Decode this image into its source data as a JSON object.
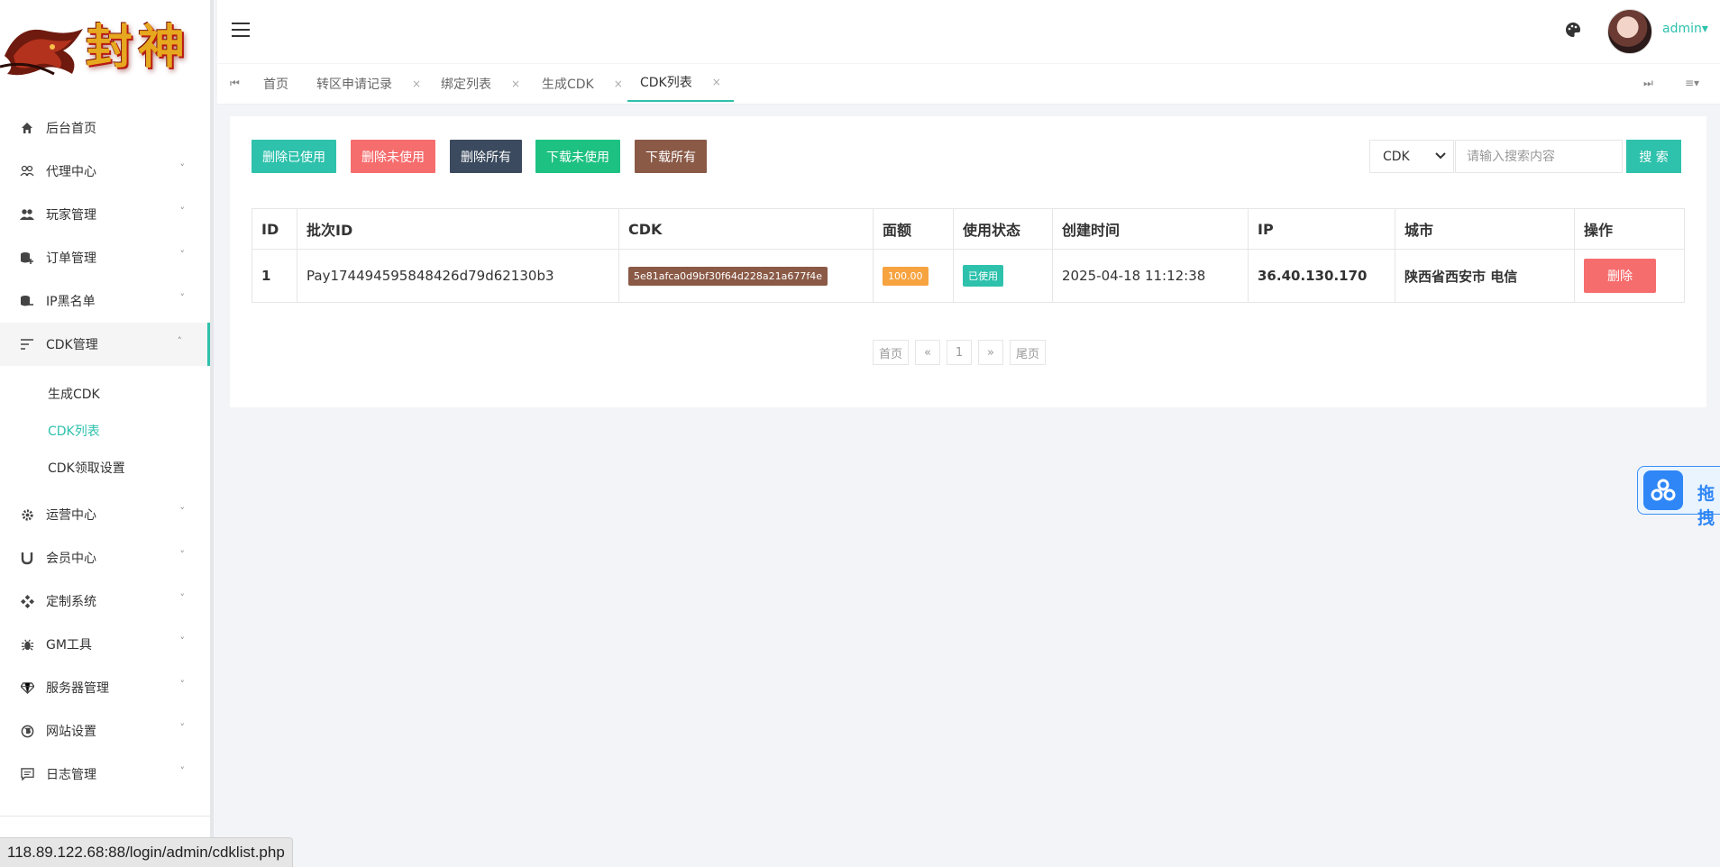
{
  "logo": {
    "text": "封神"
  },
  "header": {
    "user": "admin▾"
  },
  "sidebar": {
    "items": [
      {
        "label": "后台首页"
      },
      {
        "label": "代理中心"
      },
      {
        "label": "玩家管理"
      },
      {
        "label": "订单管理"
      },
      {
        "label": "IP黑名单"
      },
      {
        "label": "CDK管理"
      },
      {
        "label": "运营中心"
      },
      {
        "label": "会员中心"
      },
      {
        "label": "定制系统"
      },
      {
        "label": "GM工具"
      },
      {
        "label": "服务器管理"
      },
      {
        "label": "网站设置"
      },
      {
        "label": "日志管理"
      }
    ],
    "cdk_sub": [
      {
        "label": "生成CDK"
      },
      {
        "label": "CDK列表"
      },
      {
        "label": "CDK领取设置"
      }
    ]
  },
  "tabs": [
    {
      "label": "首页"
    },
    {
      "label": "转区申请记录"
    },
    {
      "label": "绑定列表"
    },
    {
      "label": "生成CDK"
    },
    {
      "label": "CDK列表"
    }
  ],
  "toolbar": {
    "delete_used": "删除已使用",
    "delete_unused": "删除未使用",
    "delete_all": "删除所有",
    "download_unused": "下载未使用",
    "download_all": "下载所有",
    "search_field": "CDK",
    "search_placeholder": "请输入搜索内容",
    "search_button": "搜 索",
    "colors": {
      "delete_used": "#2ec1ac",
      "delete_unused": "#f66d6e",
      "delete_all": "#3b4a5e",
      "download_unused": "#1dc181",
      "download_all": "#8a5a47"
    }
  },
  "table": {
    "headers": [
      "ID",
      "批次ID",
      "CDK",
      "面额",
      "使用状态",
      "创建时间",
      "IP",
      "城市",
      "操作"
    ],
    "rows": [
      {
        "id": "1",
        "batch_id": "Pay174494595848426d79d62130b3",
        "cdk": "5e81afca0d9bf30f64d228a21a677f4e",
        "amount": "100.00",
        "status": "已使用",
        "created": "2025-04-18 11:12:38",
        "ip": "36.40.130.170",
        "city": "陕西省西安市 电信",
        "action": "删除"
      }
    ]
  },
  "pager": {
    "first": "首页",
    "prev": "«",
    "page": "1",
    "next": "»",
    "last": "尾页"
  },
  "float_widget": {
    "text": "拖拽"
  },
  "status_url": "118.89.122.68:88/login/admin/cdklist.php"
}
